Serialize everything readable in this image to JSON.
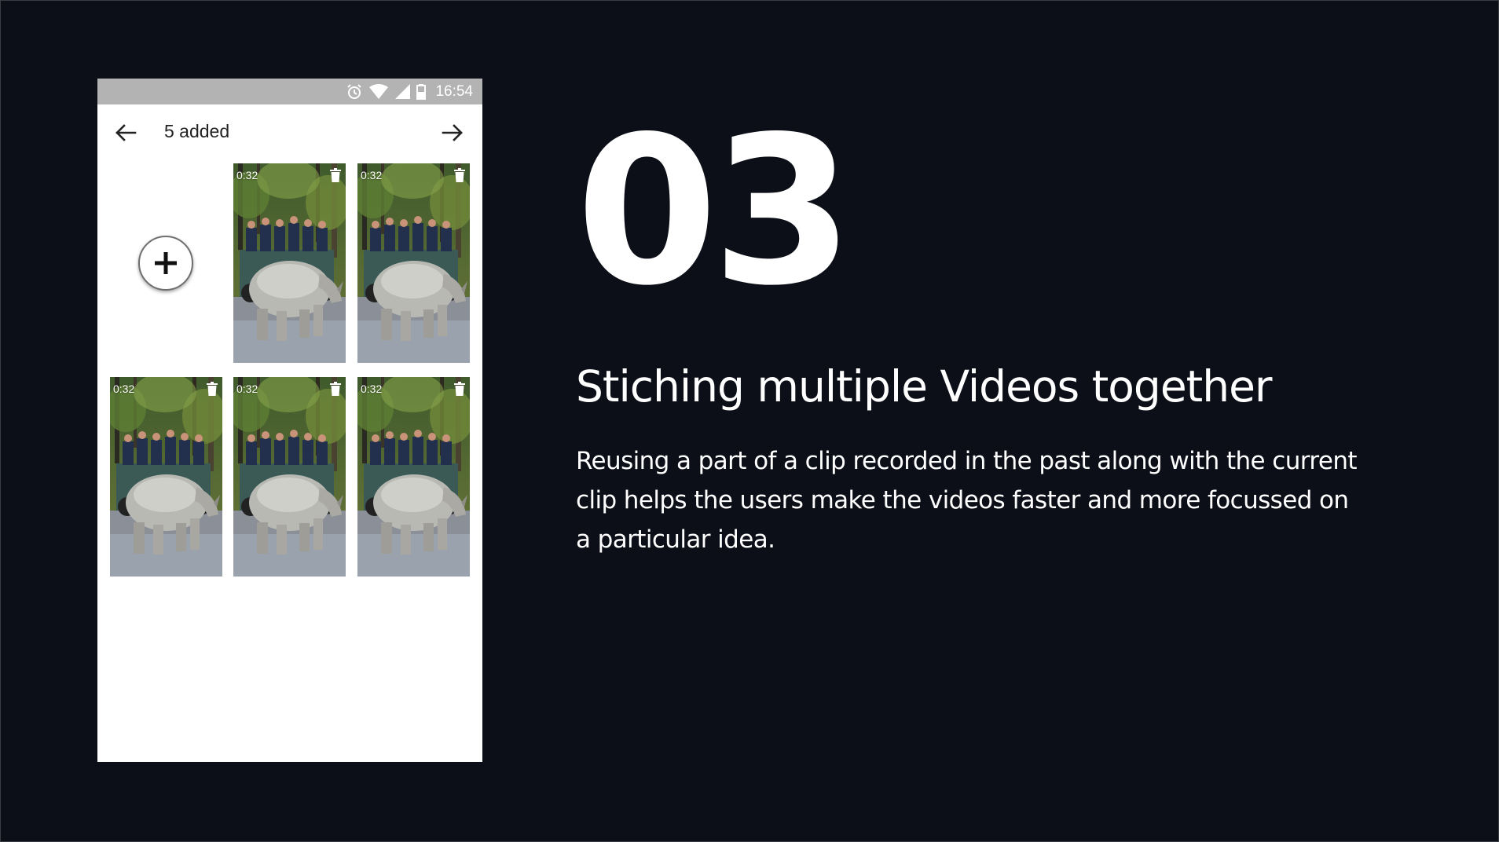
{
  "status_bar": {
    "time": "16:54",
    "icons": [
      "alarm-icon",
      "wifi-icon",
      "signal-icon",
      "battery-icon"
    ]
  },
  "app_bar": {
    "title": "5 added",
    "back_icon": "arrow-left-icon",
    "next_icon": "arrow-right-icon"
  },
  "add_button": {
    "icon": "plus-icon"
  },
  "clips": [
    {
      "duration": "0:32",
      "delete_icon": "trash-icon"
    },
    {
      "duration": "0:32",
      "delete_icon": "trash-icon"
    },
    {
      "duration": "0:32",
      "delete_icon": "trash-icon"
    },
    {
      "duration": "0:32",
      "delete_icon": "trash-icon"
    },
    {
      "duration": "0:32",
      "delete_icon": "trash-icon"
    }
  ],
  "slide": {
    "number": "03",
    "heading": "Stiching multiple Videos together",
    "description": "Reusing a part of a clip recorded in the past along with the current clip helps the users make the videos faster and more focussed on a particular idea."
  },
  "colors": {
    "background": "#0c0f17",
    "phone_bg": "#ffffff",
    "status_bar": "#b3b3b3",
    "text": "#ffffff"
  }
}
